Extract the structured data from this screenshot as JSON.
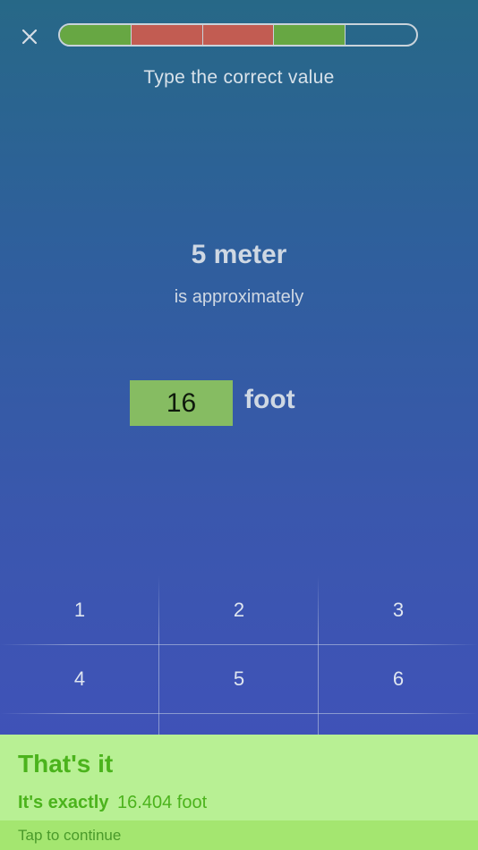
{
  "header": {
    "progress": {
      "segments": [
        {
          "state": "correct",
          "color": "#67a743"
        },
        {
          "state": "wrong",
          "color": "#c25c52"
        },
        {
          "state": "wrong",
          "color": "#c25c52"
        },
        {
          "state": "correct",
          "color": "#67a743"
        },
        {
          "state": "pending",
          "color": "transparent"
        }
      ]
    }
  },
  "question": {
    "instruction": "Type the correct value",
    "quantity": "5 meter",
    "connector": "is approximately",
    "answer": "16",
    "unit": "foot"
  },
  "keypad": {
    "keys": [
      "1",
      "2",
      "3",
      "4",
      "5",
      "6"
    ]
  },
  "feedback": {
    "title": "That's it",
    "detail_label": "It's exactly",
    "detail_value": "16.404 foot",
    "continue_label": "Tap to continue"
  },
  "colors": {
    "correct": "#67a743",
    "wrong": "#c25c52",
    "feedback_bg": "#b8f094",
    "feedback_text": "#4bb31c"
  }
}
